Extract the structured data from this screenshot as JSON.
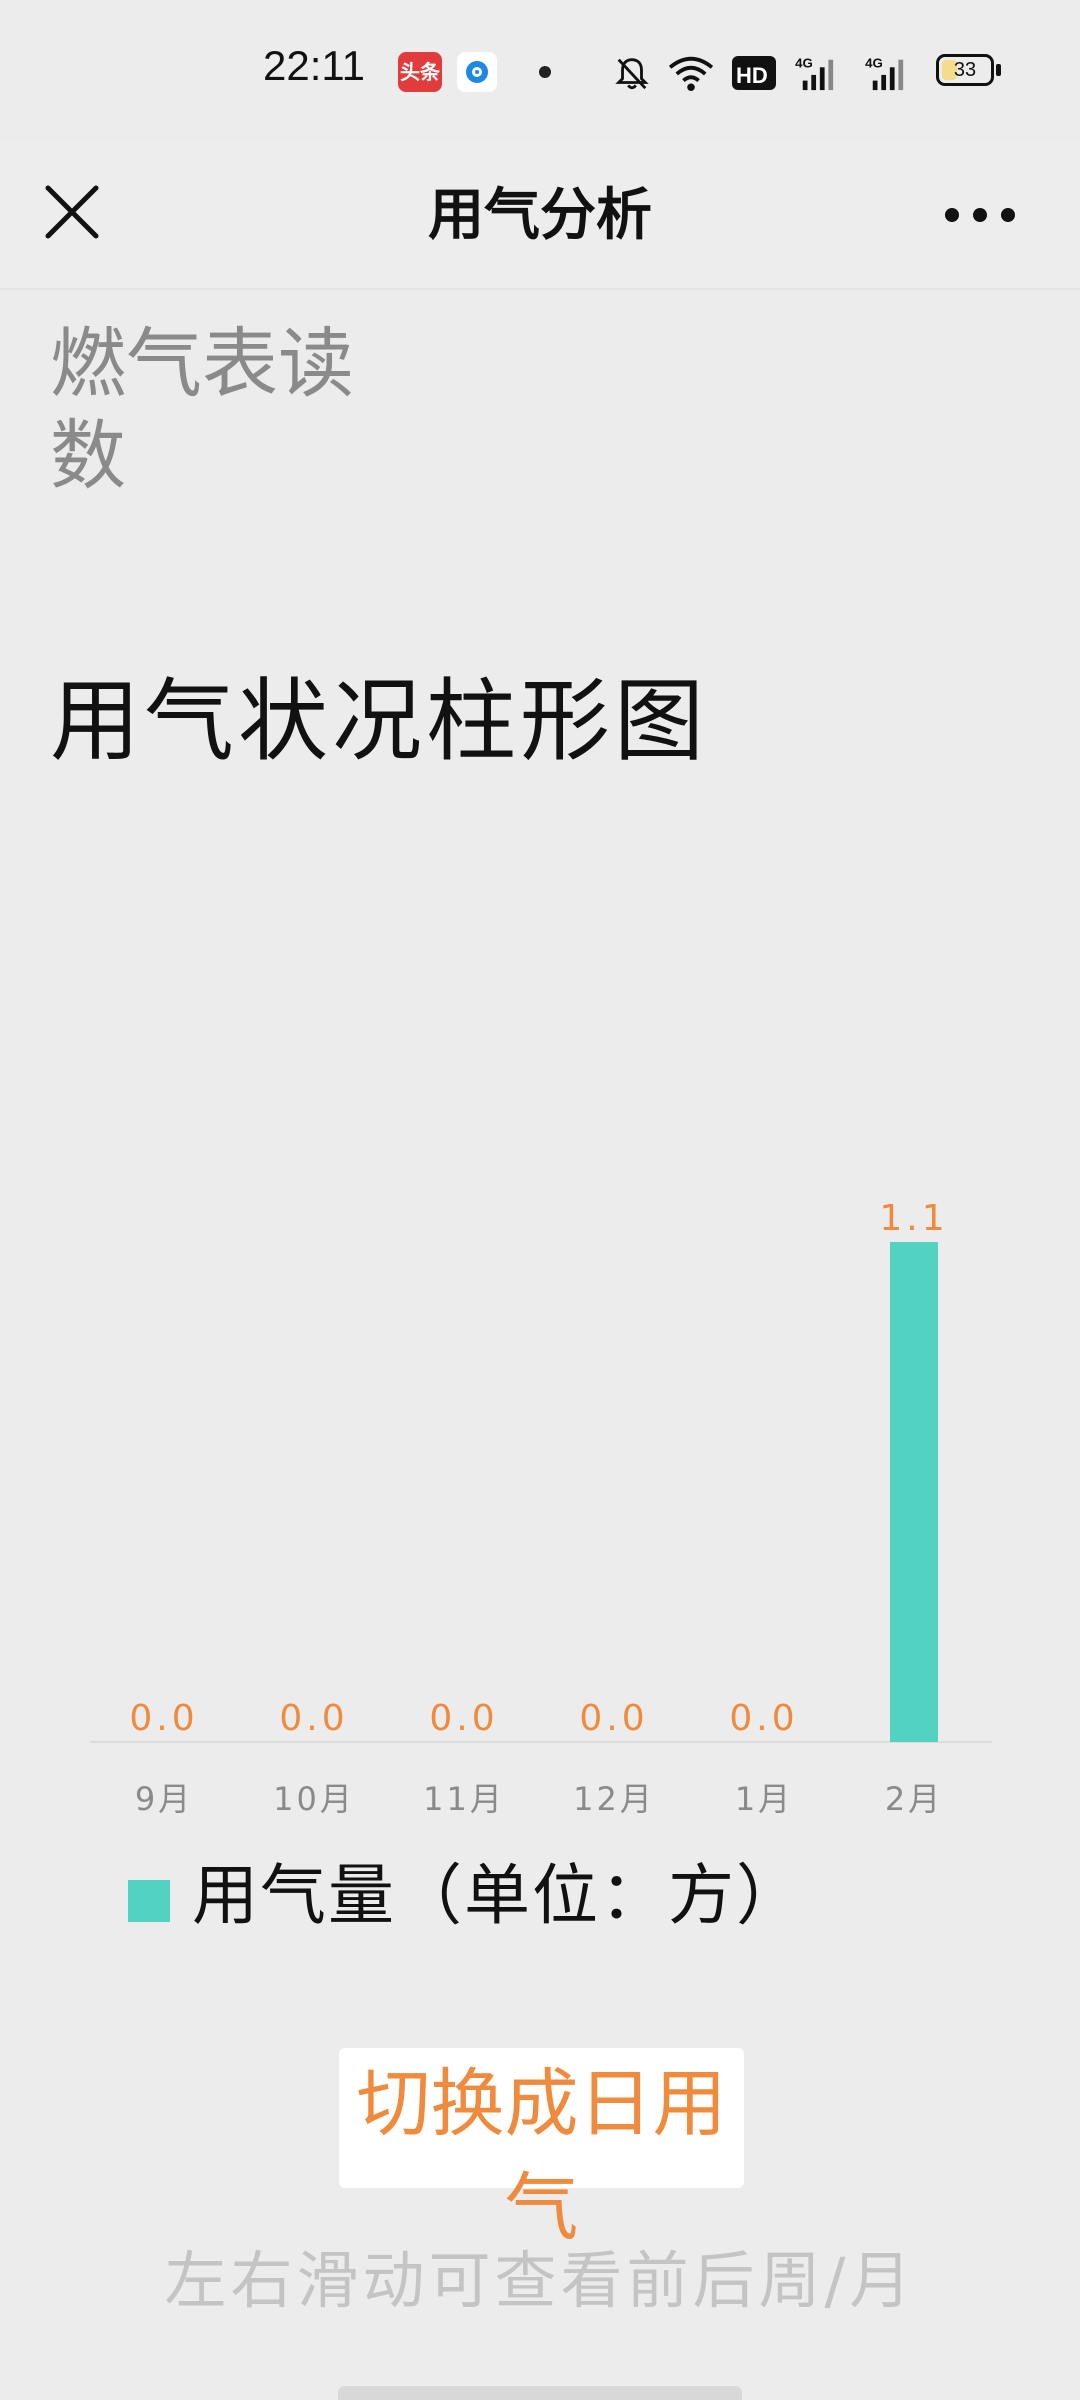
{
  "status_bar": {
    "time": "22:11",
    "app_badge_toutiao": "头条",
    "network_label": "4G",
    "battery_level": "33",
    "battery_fraction": 0.33
  },
  "nav": {
    "title": "用气分析",
    "close_icon": "close-icon",
    "more_icon": "more-icon"
  },
  "content": {
    "meter_reading_label": "燃气表读数",
    "chart_title": "用气状况柱形图",
    "legend_label": "用气量（单位：方）",
    "switch_button_label": "切换成日用气",
    "hint": "左右滑动可查看前后周/月"
  },
  "colors": {
    "bar": "#52d3c2",
    "value_label": "#f08a3c",
    "tick_label": "#8a8a8a"
  },
  "chart_data": {
    "type": "bar",
    "categories": [
      "9月",
      "10月",
      "11月",
      "12月",
      "1月",
      "2月"
    ],
    "value_labels": [
      "0.0",
      "0.0",
      "0.0",
      "0.0",
      "0.0",
      "1.1"
    ],
    "series": [
      {
        "name": "用气量（单位：方）",
        "values": [
          0.0,
          0.0,
          0.0,
          0.0,
          0.0,
          1.1
        ]
      }
    ],
    "title": "用气状况柱形图",
    "ylim": [
      0,
      1.1
    ],
    "grid": false,
    "legend_position": "bottom-left"
  }
}
